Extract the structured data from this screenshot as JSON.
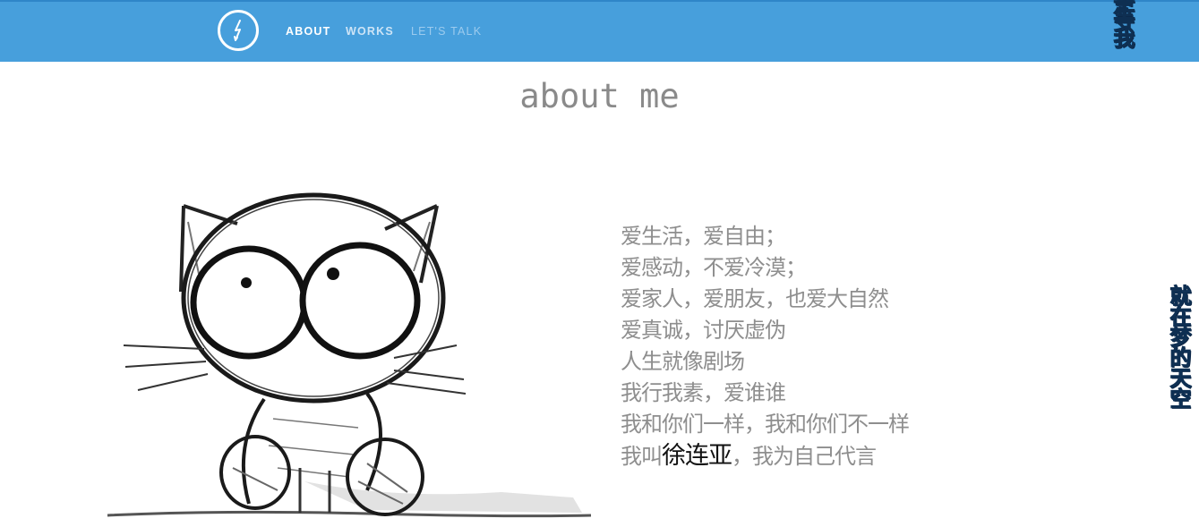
{
  "nav": {
    "items": [
      {
        "label": "ABOUT"
      },
      {
        "label": "WORKS"
      },
      {
        "label": "LET'S TALK"
      }
    ]
  },
  "side_texts": {
    "top": "事等我",
    "right": "就在梦的天空"
  },
  "page": {
    "title": "about me"
  },
  "bio": {
    "lines": [
      "爱生活，爱自由；",
      "爱感动，不爱冷漠；",
      "爱家人，爱朋友，也爱大自然",
      "爱真诚，讨厌虚伪",
      "人生就像剧场",
      "我行我素，爱谁谁",
      "我和你们一样，我和你们不一样"
    ],
    "last_line": {
      "prefix": "我叫",
      "name": "徐连亚",
      "suffix": "，我为自己代言"
    }
  },
  "colors": {
    "navbar": "#479fdc",
    "title_text": "#8a8a8a",
    "bio_text": "#8e8e8e",
    "name_highlight": "#111111",
    "side_text": "#2a5a8a"
  },
  "icons": {
    "logo": "lightning-bolt-circle-icon"
  }
}
